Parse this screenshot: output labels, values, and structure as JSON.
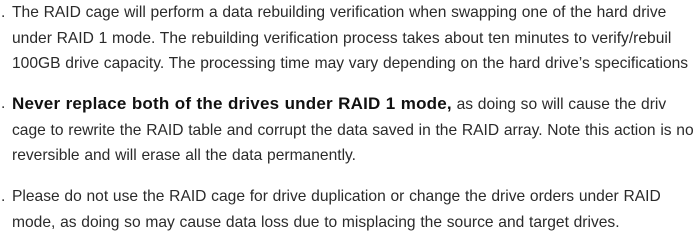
{
  "paragraphs": [
    {
      "marker": ".",
      "lines": [
        "The RAID cage will perform a data rebuilding verification when swapping one of the hard drive",
        "under RAID 1 mode. The rebuilding verification process takes about ten minutes to verify/rebuil",
        "100GB drive capacity. The processing time may vary depending on the hard drive’s specifications"
      ]
    },
    {
      "marker": ".",
      "bold_lead": "Never replace both of the drives under RAID 1 mode,",
      "lead_rest": " as doing so will cause the driv",
      "lines": [
        "cage to rewrite the RAID table and corrupt the data saved in the RAID array. Note this action is no",
        "reversible and will erase all the data permanently."
      ]
    },
    {
      "marker": ".",
      "lines": [
        "Please do not use the RAID cage for drive duplication or change the drive orders under RAID",
        "mode, as doing so may cause data loss due to misplacing the source and target drives."
      ]
    }
  ]
}
